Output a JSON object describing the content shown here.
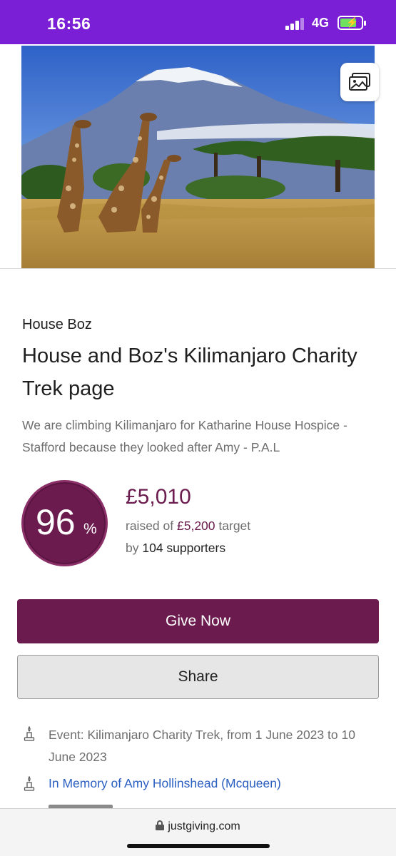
{
  "status_bar": {
    "time": "16:56",
    "network": "4G",
    "background": "#7a1fd6"
  },
  "hero": {
    "gallery_icon": "image-gallery-icon"
  },
  "page": {
    "owner": "House Boz",
    "title": "House and Boz's Kilimanjaro Charity Trek page",
    "description": "We are climbing Kilimanjaro for Katharine House Hospice - Stafford because they looked after Amy - P.A.L"
  },
  "fundraising": {
    "percent": "96",
    "percent_unit": "%",
    "raised": "£5,010",
    "raised_of_label": "raised of",
    "target": "£5,200",
    "target_label": "target",
    "by_label": "by",
    "supporters": "104 supporters",
    "accent_color": "#6b1b4e"
  },
  "actions": {
    "give_label": "Give Now",
    "share_label": "Share"
  },
  "details": {
    "event_text": "Event: Kilimanjaro Charity Trek, from 1 June 2023 to 10 June 2023",
    "memory_text": "In Memory of Amy Hollinshead (Mcqueen)",
    "icon": "candle-icon"
  },
  "browser": {
    "url": "justgiving.com",
    "lock_icon": "lock-icon"
  }
}
